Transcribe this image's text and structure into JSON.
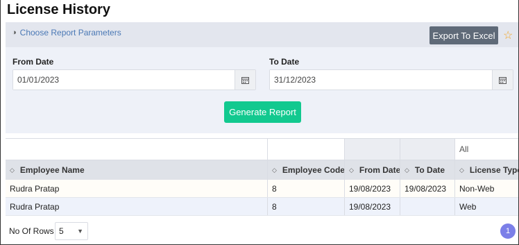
{
  "page": {
    "title": "License History"
  },
  "params_bar": {
    "link_label": "Choose Report Parameters",
    "link_icon": "half-circle-icon",
    "export_label": "Export To Excel",
    "favorite_icon": "star-outline-icon"
  },
  "form": {
    "from_label": "From Date",
    "from_value": "01/01/2023",
    "to_label": "To Date",
    "to_value": "31/12/2023",
    "calendar_icon": "calendar-icon",
    "generate_label": "Generate Report"
  },
  "grid": {
    "filter_select": "All",
    "columns": [
      "Employee Name",
      "Employee Code",
      "From Date",
      "To Date",
      "License Type"
    ],
    "rows": [
      [
        "Rudra Pratap",
        "8",
        "19/08/2023",
        "19/08/2023",
        "Non-Web"
      ],
      [
        "Rudra Pratap",
        "8",
        "19/08/2023",
        "",
        "Web"
      ]
    ]
  },
  "footer": {
    "rows_label": "No Of Rows :",
    "rows_value": "5",
    "current_page": "1"
  },
  "colors": {
    "accent_green": "#12c98f",
    "export_btn": "#5f6a78",
    "star": "#f4a623",
    "link": "#4a78b5",
    "page_badge": "#7b7fe8"
  }
}
